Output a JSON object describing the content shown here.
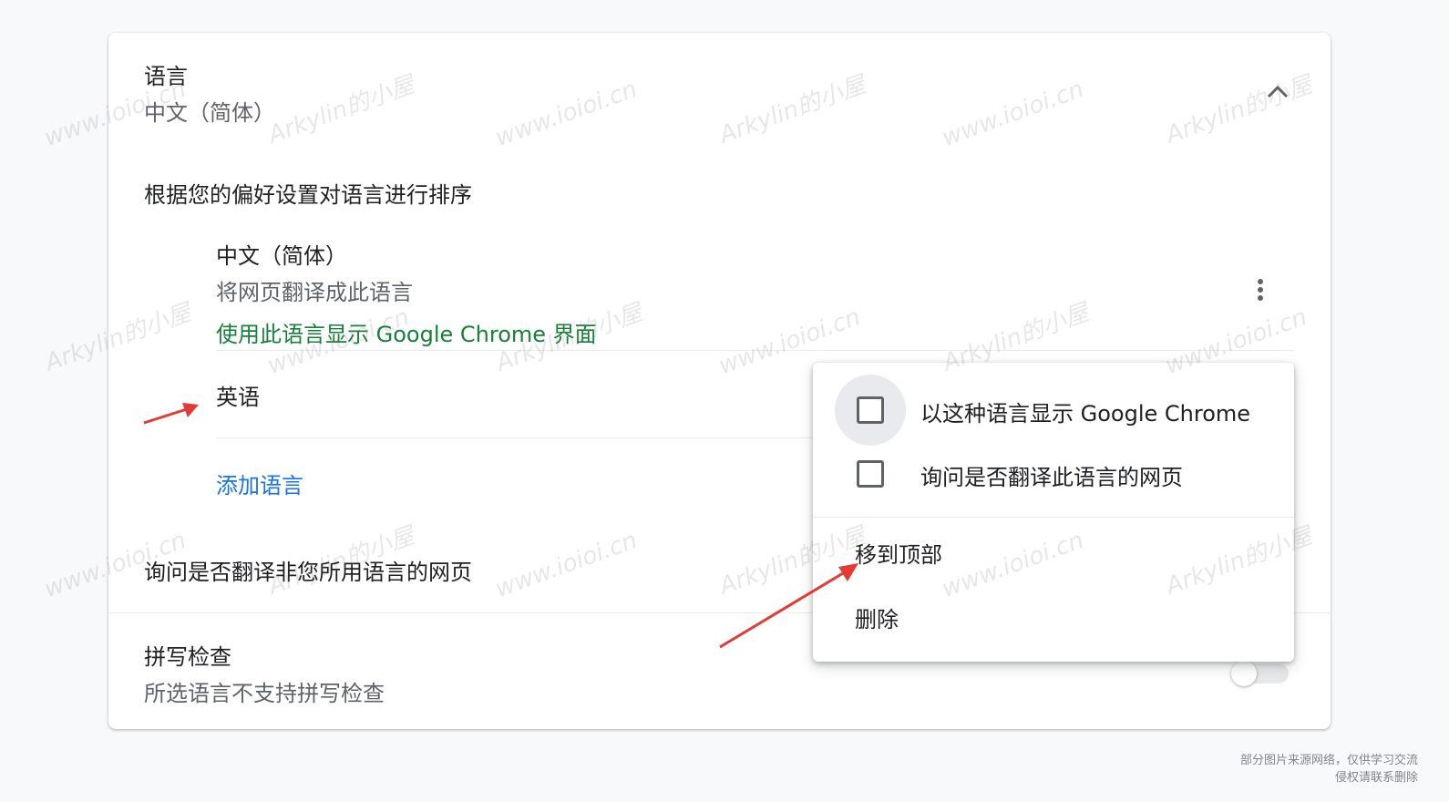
{
  "language_section": {
    "title": "语言",
    "current": "中文（简体）",
    "sort_hint": "根据您的偏好设置对语言进行排序",
    "languages": [
      {
        "name": "中文（简体）",
        "translate_note": "将网页翻译成此语言",
        "ui_note": "使用此语言显示 Google Chrome 界面"
      },
      {
        "name": "英语"
      }
    ],
    "add_language": "添加语言",
    "ask_translate": "询问是否翻译非您所用语言的网页"
  },
  "spellcheck": {
    "title": "拼写检查",
    "subtitle": "所选语言不支持拼写检查"
  },
  "context_menu": {
    "display_chrome": "以这种语言显示 Google Chrome",
    "ask_translate": "询问是否翻译此语言的网页",
    "move_top": "移到顶部",
    "remove": "删除"
  },
  "watermarks": {
    "site": "www.ioioi.cn",
    "owner": "Arkylin的小屋"
  },
  "footnote": {
    "line1": "部分图片来源网络，仅供学习交流",
    "line2": "侵权请联系删除"
  },
  "colors": {
    "accent_blue": "#1a73e8",
    "green": "#188038",
    "arrow_red": "#e53935"
  }
}
